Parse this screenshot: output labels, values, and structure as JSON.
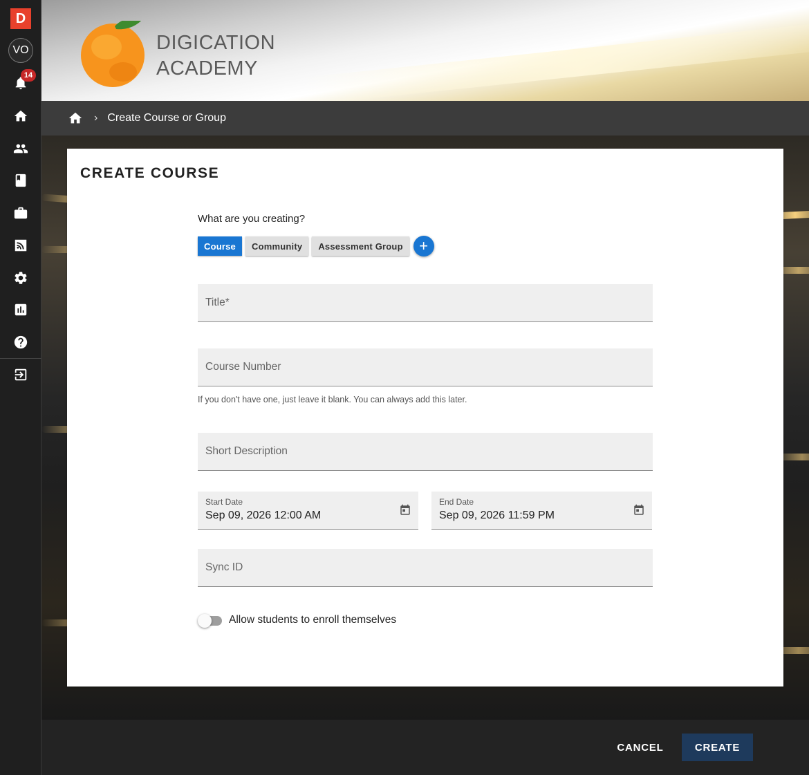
{
  "sidebar": {
    "logo_letter": "D",
    "avatar_initials": "VO",
    "notification_count": "14"
  },
  "banner": {
    "academy_line1": "DIGICATION",
    "academy_line2": "ACADEMY"
  },
  "breadcrumb": {
    "current": "Create Course or Group"
  },
  "form": {
    "title": "CREATE COURSE",
    "question": "What are you creating?",
    "types": [
      "Course",
      "Community",
      "Assessment Group"
    ],
    "add_symbol": "+",
    "title_placeholder": "Title*",
    "course_number_placeholder": "Course Number",
    "course_number_helper": "If you don't have one, just leave it blank. You can always add this later.",
    "short_description_placeholder": "Short Description",
    "start_date_label": "Start Date",
    "start_date_value": "Sep 09, 2026 12:00 AM",
    "end_date_label": "End Date",
    "end_date_value": "Sep 09, 2026 11:59 PM",
    "sync_id_placeholder": "Sync ID",
    "self_enroll_label": "Allow students to enroll themselves"
  },
  "footer": {
    "cancel_label": "CANCEL",
    "create_label": "CREATE"
  },
  "colors": {
    "accent": "#1976d2",
    "create_button": "#1e3a5c",
    "logo": "#e8412c",
    "badge": "#c62828"
  }
}
